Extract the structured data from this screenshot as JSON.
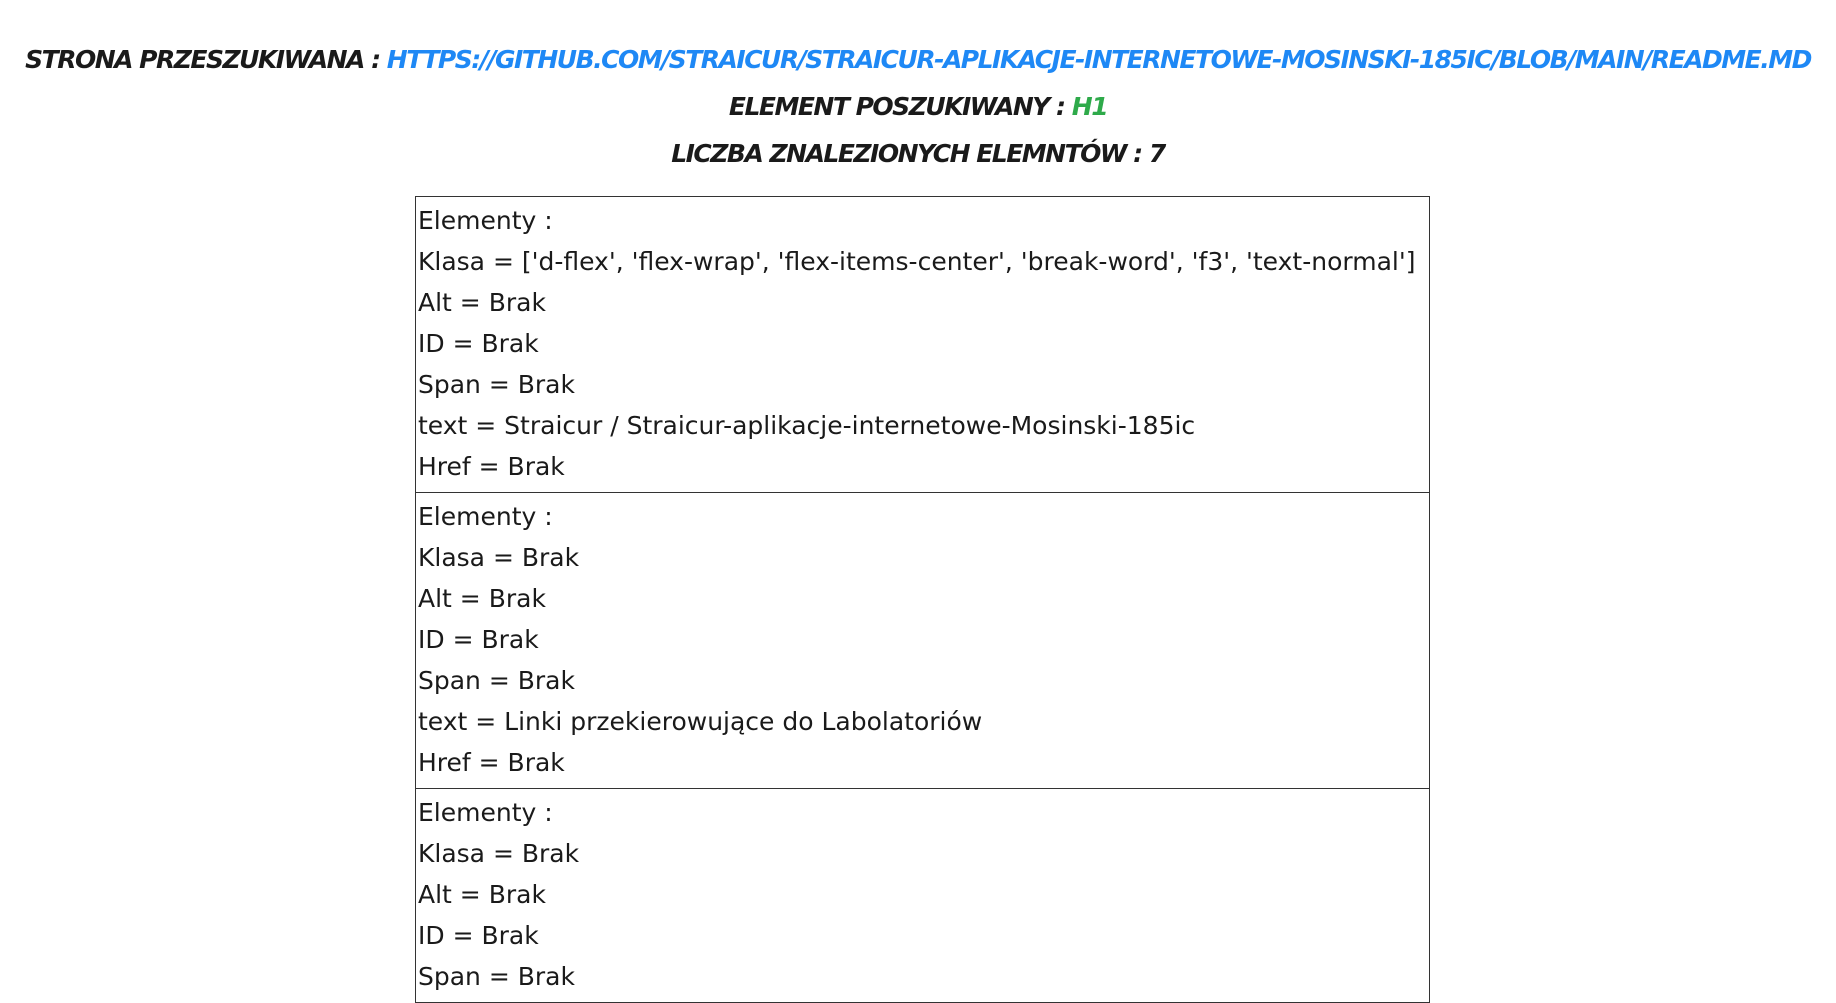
{
  "header": {
    "page_label": "Strona przeszukiwana : ",
    "page_url": "https://github.com/Straicur/Straicur-aplikacje-internetowe-Mosinski-185ic/blob/main/README.md",
    "element_label": "Element poszukiwany : ",
    "element_value": "h1",
    "count_label": "Liczba znalezionych elemntów : ",
    "count_value": "7"
  },
  "colors": {
    "link": "#1e88f5",
    "element_value": "#2eaa4a",
    "border": "#333333"
  },
  "results": [
    {
      "heading": "Elementy :",
      "klasa": "Klasa = ['d-flex', 'flex-wrap', 'flex-items-center', 'break-word', 'f3', 'text-normal']",
      "alt": "Alt = Brak",
      "id": "ID = Brak",
      "span": "Span = Brak",
      "text": "text = Straicur / Straicur-aplikacje-internetowe-Mosinski-185ic",
      "href": "Href = Brak"
    },
    {
      "heading": "Elementy :",
      "klasa": "Klasa = Brak",
      "alt": "Alt = Brak",
      "id": "ID = Brak",
      "span": "Span = Brak",
      "text": "text = Linki przekierowujące do Labolatoriów",
      "href": "Href = Brak"
    },
    {
      "heading": "Elementy :",
      "klasa": "Klasa = Brak",
      "alt": "Alt = Brak",
      "id": "ID = Brak",
      "span": "Span = Brak"
    }
  ]
}
